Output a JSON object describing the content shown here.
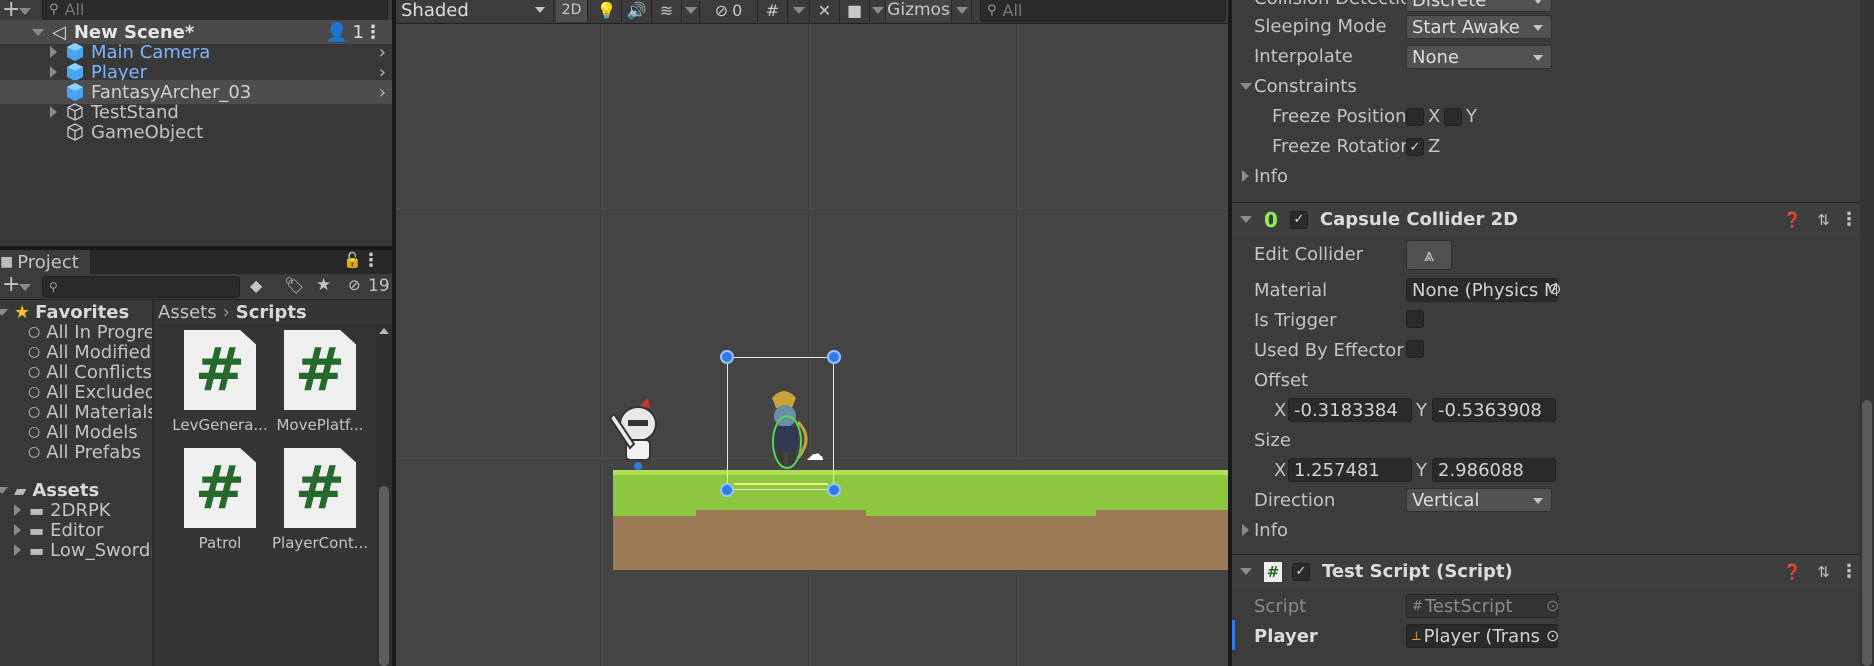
{
  "hierarchy": {
    "search_placeholder": "All",
    "scene_name": "New Scene*",
    "scene_badge": "1",
    "items": [
      {
        "label": "Main Camera",
        "color": "#7fb3ff"
      },
      {
        "label": "Player",
        "color": "#7fb3ff"
      },
      {
        "label": "FantasyArcher_03",
        "color": "#c4c4c4"
      },
      {
        "label": "TestStand",
        "color": "#c4c4c4"
      },
      {
        "label": "GameObject",
        "color": "#c4c4c4"
      }
    ]
  },
  "project": {
    "tab_label": "Project",
    "hidden_count": "19",
    "favorites_label": "Favorites",
    "favorites": [
      "All In Progress",
      "All Modified",
      "All Conflicts",
      "All Excluded",
      "All Materials",
      "All Models",
      "All Prefabs"
    ],
    "assets_label": "Assets",
    "assets_folders": [
      "2DRPK",
      "Editor",
      "Low_Swordma"
    ],
    "breadcrumb": {
      "root": "Assets",
      "current": "Scripts"
    },
    "files": [
      "LevGenera...",
      "MovePlatf...",
      "Patrol",
      "PlayerCont..."
    ]
  },
  "scene_toolbar": {
    "shading_mode": "Shaded",
    "mode_2d": "2D",
    "hidden_count": "0",
    "gizmos_label": "Gizmos",
    "search_placeholder": "All"
  },
  "inspector": {
    "rigidbody": {
      "collision_detection_label": "Collision Detection",
      "collision_detection_value": "Discrete",
      "sleeping_mode_label": "Sleeping Mode",
      "sleeping_mode_value": "Start Awake",
      "interpolate_label": "Interpolate",
      "interpolate_value": "None",
      "constraints_label": "Constraints",
      "freeze_position_label": "Freeze Position",
      "freeze_rotation_label": "Freeze Rotation",
      "axis_x": "X",
      "axis_y": "Y",
      "axis_z": "Z",
      "info_label": "Info"
    },
    "capsule_collider": {
      "title": "Capsule Collider 2D",
      "edit_collider_label": "Edit Collider",
      "material_label": "Material",
      "material_value": "None (Physics M",
      "is_trigger_label": "Is Trigger",
      "used_by_effector_label": "Used By Effector",
      "offset_label": "Offset",
      "offset_x": "-0.3183384",
      "offset_y": "-0.5363908",
      "size_label": "Size",
      "size_x": "1.257481",
      "size_y": "2.986088",
      "axis_x": "X",
      "axis_y": "Y",
      "direction_label": "Direction",
      "direction_value": "Vertical",
      "info_label": "Info"
    },
    "test_script": {
      "title": "Test Script (Script)",
      "script_label": "Script",
      "script_value": "TestScript",
      "player_label": "Player",
      "player_value": "Player (Trans"
    }
  },
  "colors": {
    "accent_blue": "#2f7ce8",
    "grass": "#8dc63f",
    "dirt": "#9c7a55",
    "script_green": "#26692d"
  }
}
